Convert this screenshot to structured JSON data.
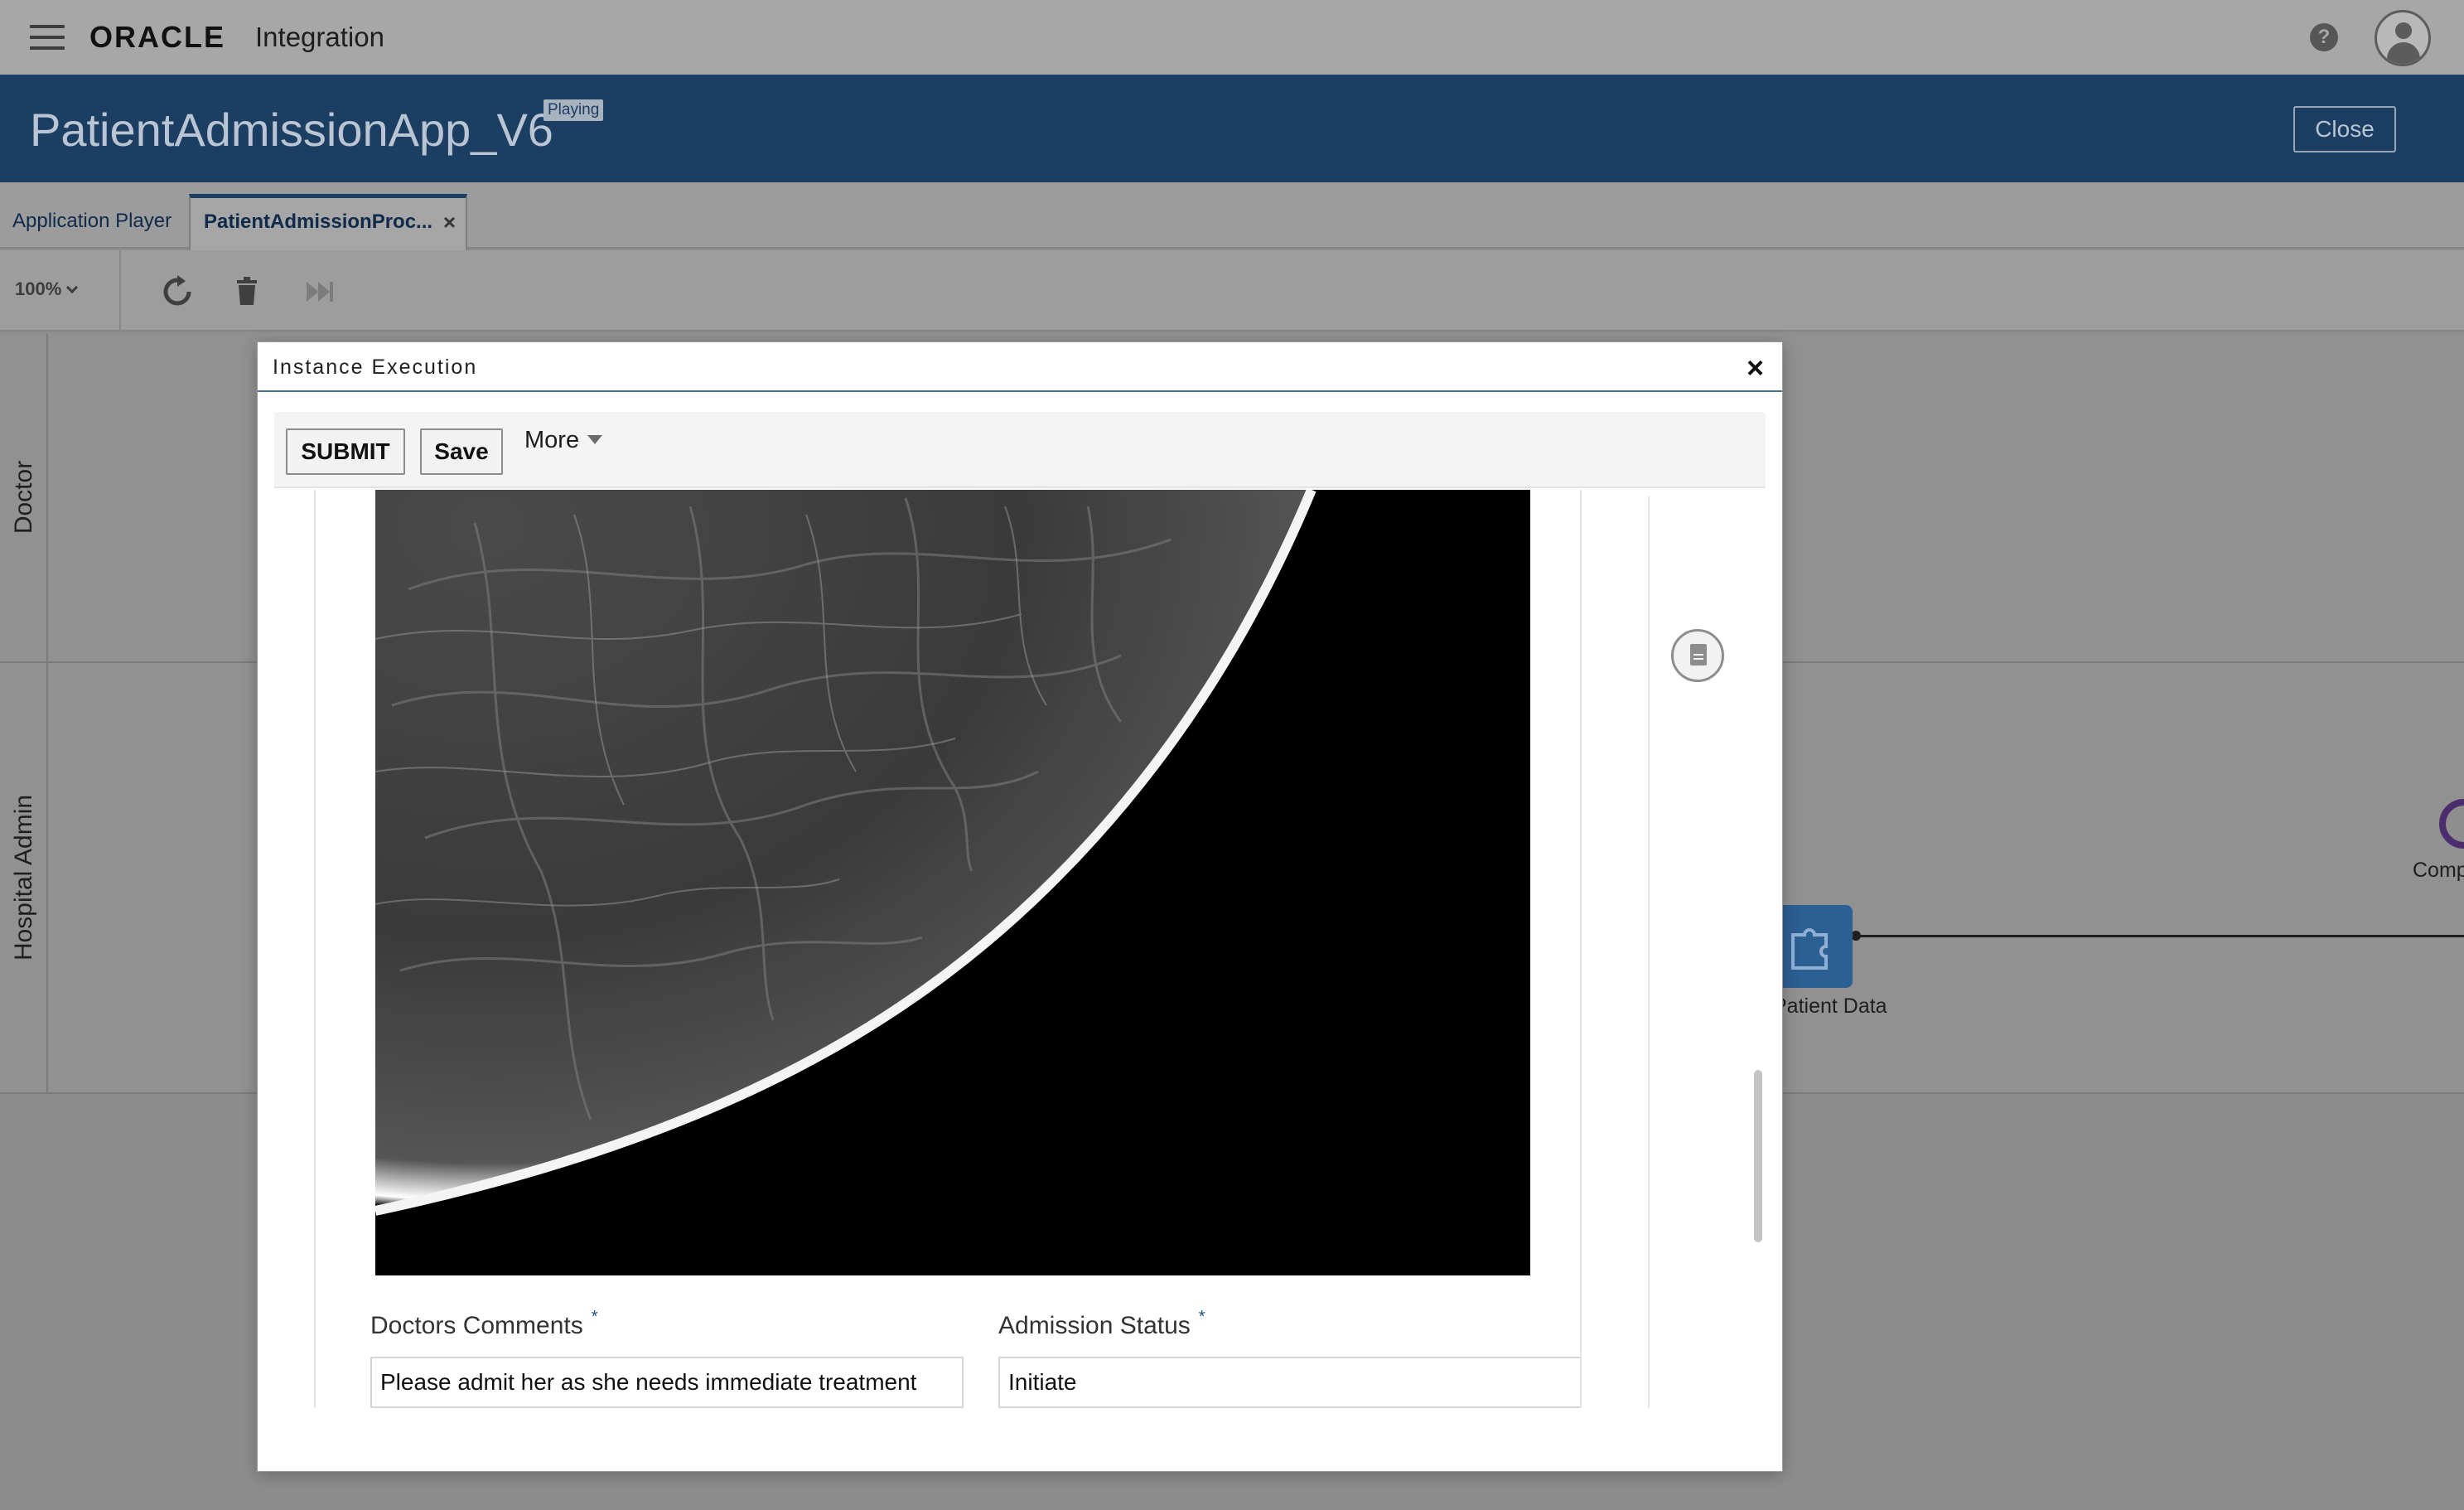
{
  "topbar": {
    "logo_text": "ORACLE",
    "product": "Integration",
    "help_symbol": "?"
  },
  "header": {
    "app_title": "PatientAdmissionApp_V6",
    "status_badge": "Playing",
    "close_label": "Close"
  },
  "tabs": [
    {
      "label": "Application Player",
      "active": false
    },
    {
      "label": "PatientAdmissionProc...",
      "active": true,
      "close_symbol": "×"
    }
  ],
  "toolbar": {
    "zoom": "100%",
    "icons": [
      "refresh-icon",
      "trash-icon",
      "skip-forward-icon"
    ]
  },
  "swimlanes": [
    {
      "label": "Doctor"
    },
    {
      "label": "Hospital Admin"
    }
  ],
  "process_nodes": {
    "task_label": "Patient Data",
    "end_label": "Comp"
  },
  "dialog": {
    "title": "Instance Execution",
    "close_symbol": "×",
    "actions": {
      "submit_label": "SUBMIT",
      "save_label": "Save",
      "more_label": "More"
    },
    "form": {
      "image_description_icon": "xray-image",
      "doctors_comments": {
        "label": "Doctors Comments",
        "required_mark": "*",
        "value": "Please admit her as she needs immediate treatment"
      },
      "admission_status": {
        "label": "Admission Status",
        "required_mark": "*",
        "value": "Initiate"
      }
    },
    "side_panel_icon": "document-icon"
  },
  "colors": {
    "brand_blue": "#1c3e63",
    "task_blue": "#2c5f92",
    "end_purple": "#4b2d6e"
  }
}
